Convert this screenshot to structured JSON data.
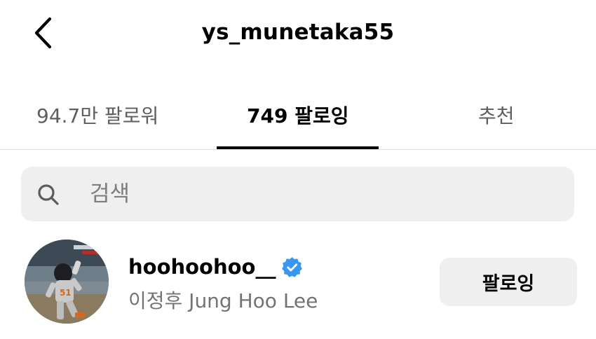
{
  "header": {
    "title": "ys_munetaka55",
    "back_icon": "chevron-left-icon"
  },
  "tabs": [
    {
      "label": "94.7만 팔로워",
      "active": false
    },
    {
      "label": "749 팔로잉",
      "active": true
    },
    {
      "label": "추천",
      "active": false
    }
  ],
  "search": {
    "placeholder": "검색",
    "icon": "search-icon",
    "value": ""
  },
  "users": [
    {
      "username": "hoohoohoo__",
      "full_name": "이정후 Jung Hoo Lee",
      "verified": true,
      "button_label": "팔로잉",
      "avatar_icon": "baseball-player-photo"
    }
  ],
  "colors": {
    "verified_badge": "#3897f0",
    "button_bg": "#efeff0",
    "secondary_text": "#737373"
  }
}
